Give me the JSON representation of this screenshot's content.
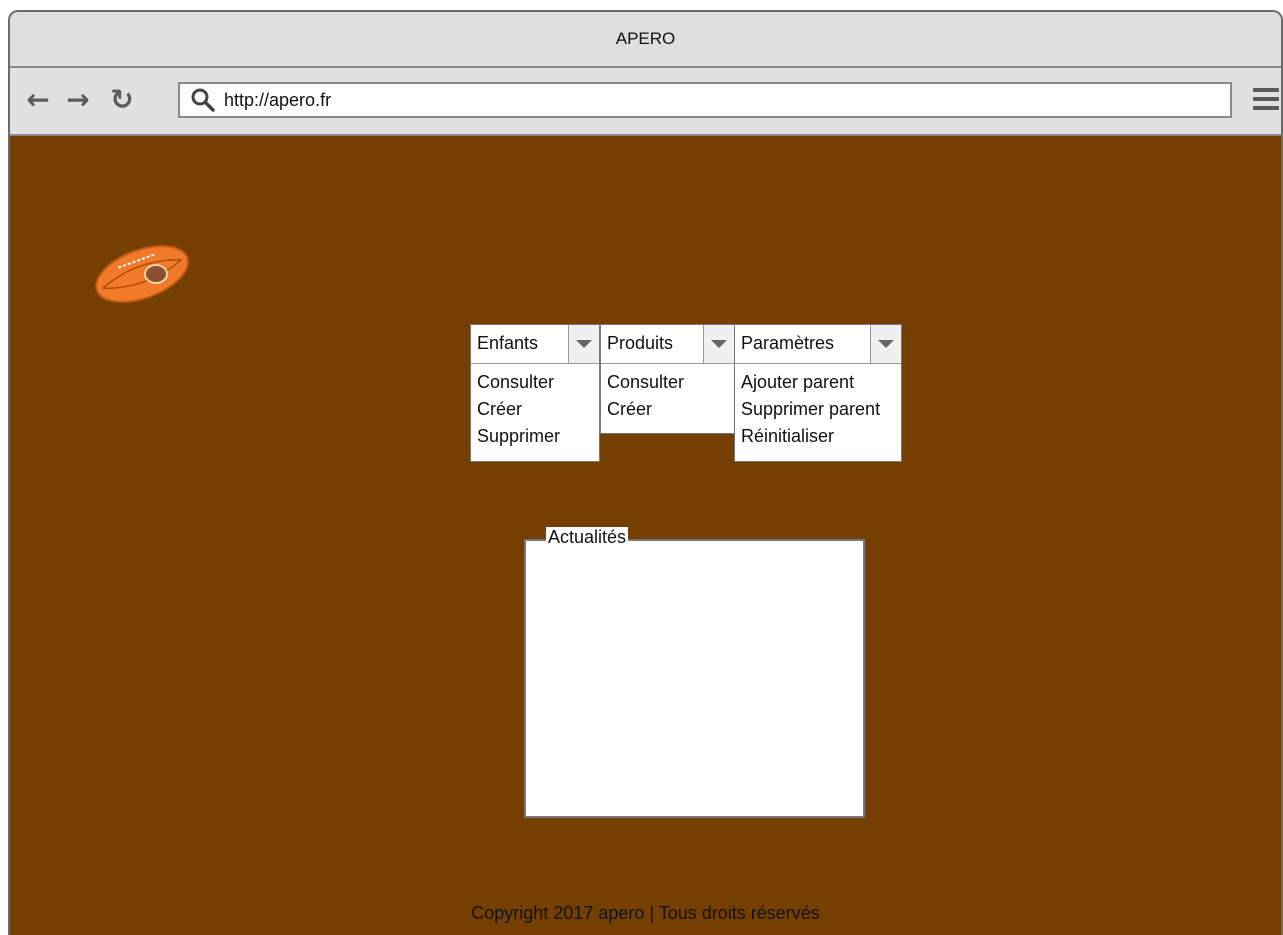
{
  "window": {
    "title": "APERO"
  },
  "toolbar": {
    "back_icon": "arrow-left-icon",
    "forward_icon": "arrow-right-icon",
    "reload_icon": "reload-icon",
    "url": "http://apero.fr",
    "menu_icon": "hamburger-menu-icon"
  },
  "page": {
    "background": "#753f02",
    "logo": "rugby-ball-logo",
    "menus": [
      {
        "label": "Enfants",
        "items": [
          "Consulter",
          "Créer",
          "Supprimer"
        ]
      },
      {
        "label": "Produits",
        "items": [
          "Consulter",
          "Créer"
        ]
      },
      {
        "label": "Paramètres",
        "items": [
          "Ajouter parent",
          "Supprimer parent",
          "Réinitialiser"
        ]
      }
    ],
    "news": {
      "label": "Actualités"
    },
    "footer": "Copyright 2017 apero | Tous droits réservés"
  }
}
